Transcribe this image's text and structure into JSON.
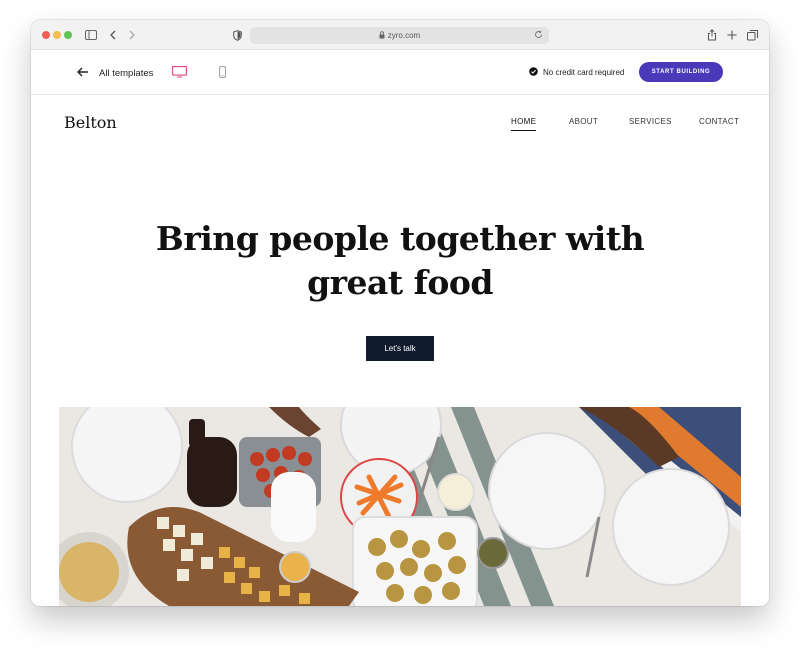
{
  "browser": {
    "url": "zyro.com"
  },
  "editor": {
    "back_label": "All templates",
    "no_card_text": "No credit card required",
    "start_button": "START BUILDING"
  },
  "site": {
    "logo": "Belton",
    "nav": {
      "home": "HOME",
      "about": "ABOUT",
      "services": "SERVICES",
      "contact": "CONTACT"
    },
    "hero": {
      "line1": "Bring people together with",
      "line2": "great food",
      "cta": "Let's talk"
    }
  },
  "colors": {
    "accent": "#4a39b8",
    "cta_bg": "#0f1a2c",
    "active_device": "#e0457b"
  },
  "icons": [
    "sidebar-toggle-icon",
    "chevron-left-icon",
    "chevron-right-icon",
    "shield-icon",
    "lock-icon",
    "reload-icon",
    "share-icon",
    "plus-icon",
    "tabs-icon",
    "arrow-left-icon",
    "desktop-icon",
    "mobile-icon",
    "check-circle-icon"
  ]
}
